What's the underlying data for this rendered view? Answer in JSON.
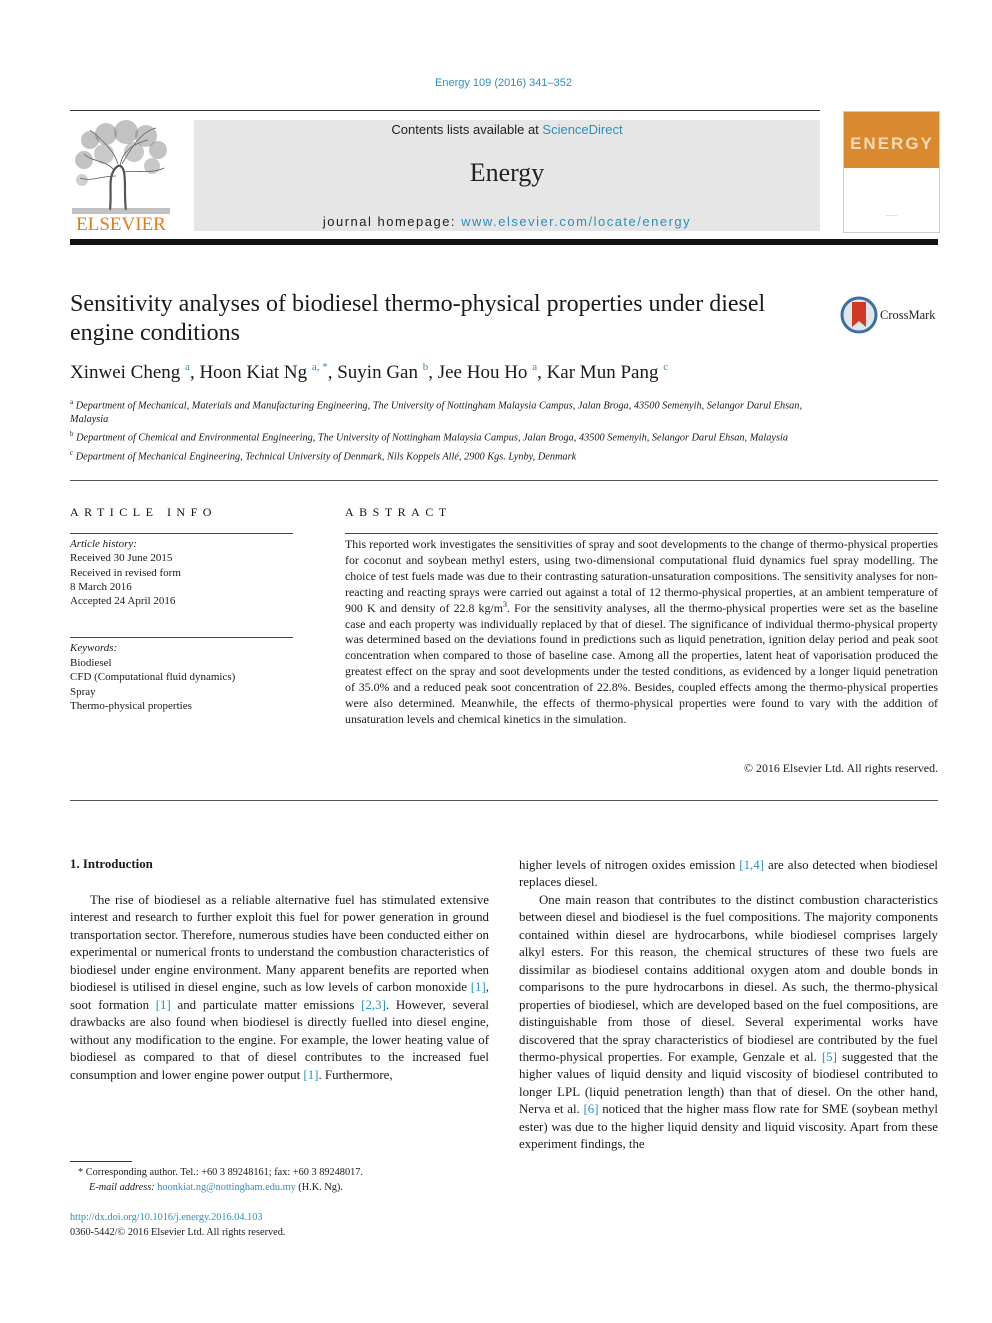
{
  "header": {
    "journal_ref": "Energy 109 (2016) 341–352",
    "contents_prefix": "Contents lists available at ",
    "contents_link": "ScienceDirect",
    "journal_name": "Energy",
    "homepage_prefix": "journal homepage: ",
    "homepage_link": "www.elsevier.com/locate/energy",
    "publisher_logo_text": "ELSEVIER",
    "cover_word": "ENERGY",
    "crossmark_label": "CrossMark"
  },
  "article": {
    "title": "Sensitivity analyses of biodiesel thermo-physical properties under diesel engine conditions",
    "authors": [
      {
        "name": "Xinwei Cheng",
        "sup": "a"
      },
      {
        "name": "Hoon Kiat Ng",
        "sup": "a, *"
      },
      {
        "name": "Suyin Gan",
        "sup": "b"
      },
      {
        "name": "Jee Hou Ho",
        "sup": "a"
      },
      {
        "name": "Kar Mun Pang",
        "sup": "c"
      }
    ],
    "affiliations": [
      {
        "sup": "a",
        "text": "Department of Mechanical, Materials and Manufacturing Engineering, The University of Nottingham Malaysia Campus, Jalan Broga, 43500 Semenyih, Selangor Darul Ehsan, Malaysia"
      },
      {
        "sup": "b",
        "text": "Department of Chemical and Environmental Engineering, The University of Nottingham Malaysia Campus, Jalan Broga, 43500 Semenyih, Selangor Darul Ehsan, Malaysia"
      },
      {
        "sup": "c",
        "text": "Department of Mechanical Engineering, Technical University of Denmark, Nils Koppels Allé, 2900 Kgs. Lynby, Denmark"
      }
    ]
  },
  "article_info": {
    "caption": "ARTICLE INFO",
    "history_label": "Article history:",
    "history": [
      "Received 30 June 2015",
      "Received in revised form",
      "8 March 2016",
      "Accepted 24 April 2016"
    ],
    "keywords_label": "Keywords:",
    "keywords": [
      "Biodiesel",
      "CFD (Computational fluid dynamics)",
      "Spray",
      "Thermo-physical properties"
    ]
  },
  "abstract": {
    "caption": "ABSTRACT",
    "text_part1": "This reported work investigates the sensitivities of spray and soot developments to the change of thermo-physical properties for coconut and soybean methyl esters, using two-dimensional computational fluid dynamics fuel spray modelling. The choice of test fuels made was due to their contrasting saturation-unsaturation compositions. The sensitivity analyses for non-reacting and reacting sprays were carried out against a total of 12 thermo-physical properties, at an ambient temperature of 900 K and density of 22.8 kg/m",
    "text_sup": "3",
    "text_part2": ". For the sensitivity analyses, all the thermo-physical properties were set as the baseline case and each property was individually replaced by that of diesel. The significance of individual thermo-physical property was determined based on the deviations found in predictions such as liquid penetration, ignition delay period and peak soot concentration when compared to those of baseline case. Among all the properties, latent heat of vaporisation produced the greatest effect on the spray and soot developments under the tested conditions, as evidenced by a longer liquid penetration of 35.0% and a reduced peak soot concentration of 22.8%. Besides, coupled effects among the thermo-physical properties were also determined. Meanwhile, the effects of thermo-physical properties were found to vary with the addition of unsaturation levels and chemical kinetics in the simulation.",
    "copyright": "© 2016 Elsevier Ltd. All rights reserved."
  },
  "body": {
    "section_heading": "1.  Introduction",
    "left": {
      "s1": "The rise of biodiesel as a reliable alternative fuel has stimulated extensive interest and research to further exploit this fuel for power generation in ground transportation sector. Therefore, numerous studies have been conducted either on experimental or numerical fronts to understand the combustion characteristics of biodiesel under engine environment. Many apparent benefits are reported when biodiesel is utilised in diesel engine, such as low levels of carbon monoxide ",
      "r1": "[1]",
      "s2": ", soot formation ",
      "r2": "[1]",
      "s3": " and particulate matter emissions ",
      "r3": "[2,3]",
      "s4": ". However, several drawbacks are also found when biodiesel is directly fuelled into diesel engine, without any modification to the engine. For example, the lower heating value of biodiesel as compared to that of diesel contributes to the increased fuel consumption and lower engine power output ",
      "r4": "[1]",
      "s5": ". Furthermore,"
    },
    "right": {
      "s1": "higher levels of nitrogen oxides emission ",
      "r1": "[1,4]",
      "s2": " are also detected when biodiesel replaces diesel.",
      "p2_s1": "One main reason that contributes to the distinct combustion characteristics between diesel and biodiesel is the fuel compositions. The majority components contained within diesel are hydrocarbons, while biodiesel comprises largely alkyl esters. For this reason, the chemical structures of these two fuels are dissimilar as biodiesel contains additional oxygen atom and double bonds in comparisons to the pure hydrocarbons in diesel. As such, the thermo-physical properties of biodiesel, which are developed based on the fuel compositions, are distinguishable from those of diesel. Several experimental works have discovered that the spray characteristics of biodiesel are contributed by the fuel thermo-physical properties. For example, Genzale et al. ",
      "p2_r1": "[5]",
      "p2_s2": " suggested that the higher values of liquid density and liquid viscosity of biodiesel contributed to longer LPL (liquid penetration length) than that of diesel. On the other hand, Nerva et al. ",
      "p2_r2": "[6]",
      "p2_s3": " noticed that the higher mass flow rate for SME (soybean methyl ester) was due to the higher liquid density and liquid viscosity. Apart from these experiment findings, the"
    }
  },
  "footnote": {
    "star_line": "*  Corresponding author. Tel.: +60 3 89248161; fax: +60 3 89248017.",
    "email_label": "E-mail address: ",
    "email": "hoonkiat.ng@nottingham.edu.my",
    "email_suffix": " (H.K. Ng).",
    "doi": "http://dx.doi.org/10.1016/j.energy.2016.04.103",
    "issn_line": "0360-5442/© 2016 Elsevier Ltd. All rights reserved."
  }
}
